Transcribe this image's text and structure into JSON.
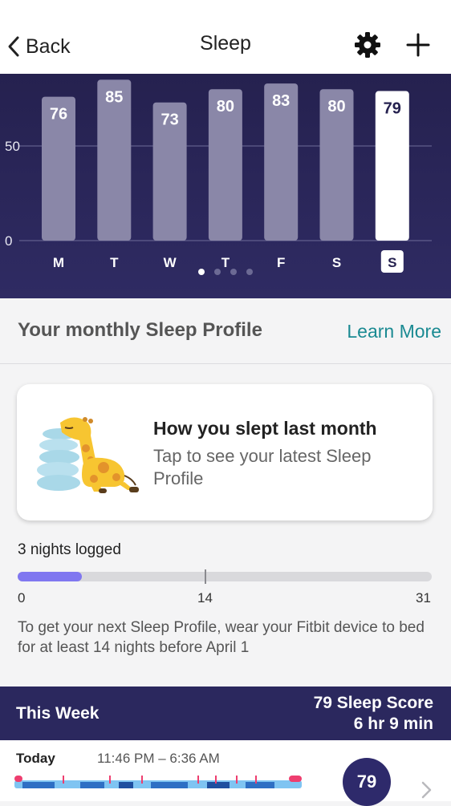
{
  "header": {
    "back_label": "Back",
    "title": "Sleep",
    "icons": [
      "chevron-left-icon",
      "gear-icon",
      "plus-icon"
    ]
  },
  "chart_data": {
    "type": "bar",
    "categories": [
      "M",
      "T",
      "W",
      "T",
      "F",
      "S",
      "S"
    ],
    "values": [
      76,
      85,
      73,
      80,
      83,
      80,
      79
    ],
    "ylim": [
      0,
      100
    ],
    "yticks": [
      "50",
      "0"
    ],
    "highlight_index": 6,
    "bar_color": "#8a87a8",
    "highlight_color": "#ffffff"
  },
  "pager": {
    "count": 4,
    "active": 0
  },
  "profile": {
    "title": "Your monthly Sleep Profile",
    "learn_more": "Learn More",
    "card_title": "How you slept last month",
    "card_subtitle": "Tap to see your latest Sleep Profile"
  },
  "progress": {
    "label": "3 nights logged",
    "logged": 3,
    "goal": 14,
    "max": 31,
    "min_label": "0",
    "goal_label": "14",
    "max_label": "31",
    "note": "To get your next Sleep Profile, wear your Fitbit device to bed for at least 14 nights before April 1",
    "fill_color": "#8077f0"
  },
  "week": {
    "title": "This Week",
    "score": "79 Sleep Score",
    "duration": "6 hr 9 min"
  },
  "today": {
    "day": "Today",
    "time": "11:46 PM – 6:36 AM",
    "score": "79"
  }
}
